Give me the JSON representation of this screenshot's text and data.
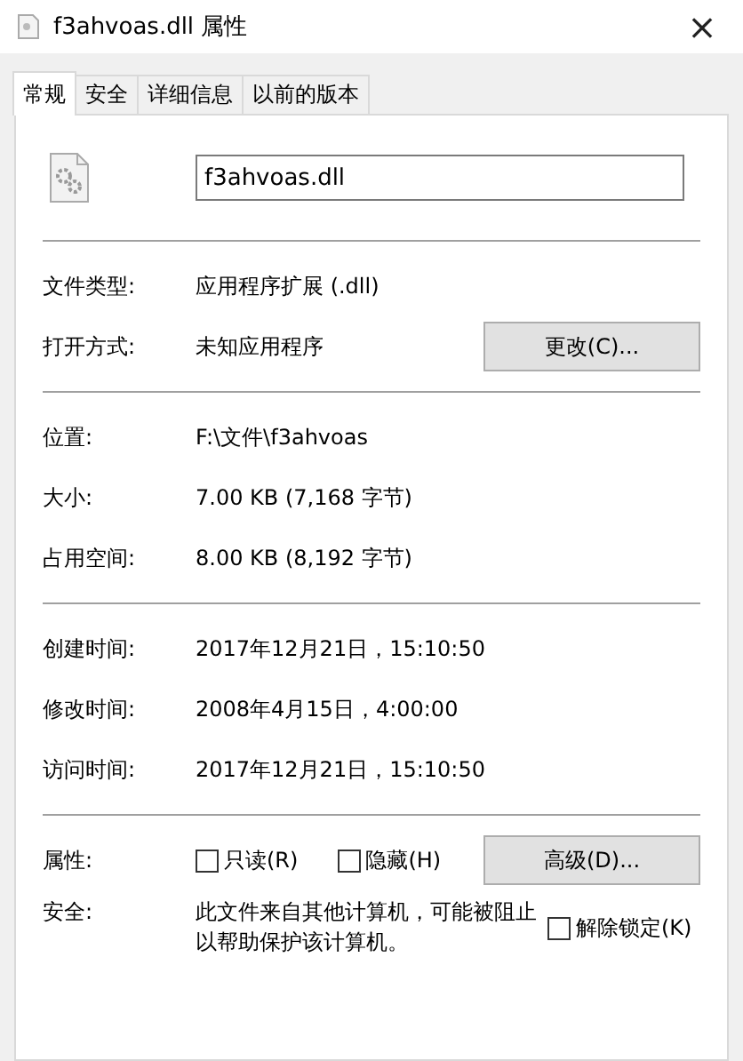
{
  "window": {
    "title": "f3ahvoas.dll 属性",
    "close": "×"
  },
  "tabs": [
    {
      "label": "常规",
      "selected": true
    },
    {
      "label": "安全",
      "selected": false
    },
    {
      "label": "详细信息",
      "selected": false
    },
    {
      "label": "以前的版本",
      "selected": false
    }
  ],
  "file_name": "f3ahvoas.dll",
  "sections": [
    [
      {
        "label": "文件类型:",
        "value": "应用程序扩展 (.dll)"
      },
      {
        "label": "打开方式:",
        "value": "未知应用程序",
        "button": "更改(C)..."
      }
    ],
    [
      {
        "label": "位置:",
        "value": "F:\\文件\\f3ahvoas"
      },
      {
        "label": "大小:",
        "value": "7.00 KB (7,168 字节)"
      },
      {
        "label": "占用空间:",
        "value": "8.00 KB (8,192 字节)"
      }
    ],
    [
      {
        "label": "创建时间:",
        "value": "2017年12月21日，15:10:50"
      },
      {
        "label": "修改时间:",
        "value": "2008年4月15日，4:00:00"
      },
      {
        "label": "访问时间:",
        "value": "2017年12月21日，15:10:50"
      }
    ]
  ],
  "attributes": {
    "label": "属性:",
    "checkboxes": [
      {
        "label": "只读(R)",
        "checked": false
      },
      {
        "label": "隐藏(H)",
        "checked": false
      }
    ],
    "button": "高级(D)..."
  },
  "security": {
    "label": "安全:",
    "text": "此文件来自其他计算机，可能被阻止以帮助保护该计算机。",
    "checkbox": {
      "label": "解除锁定(K)",
      "checked": false
    }
  }
}
